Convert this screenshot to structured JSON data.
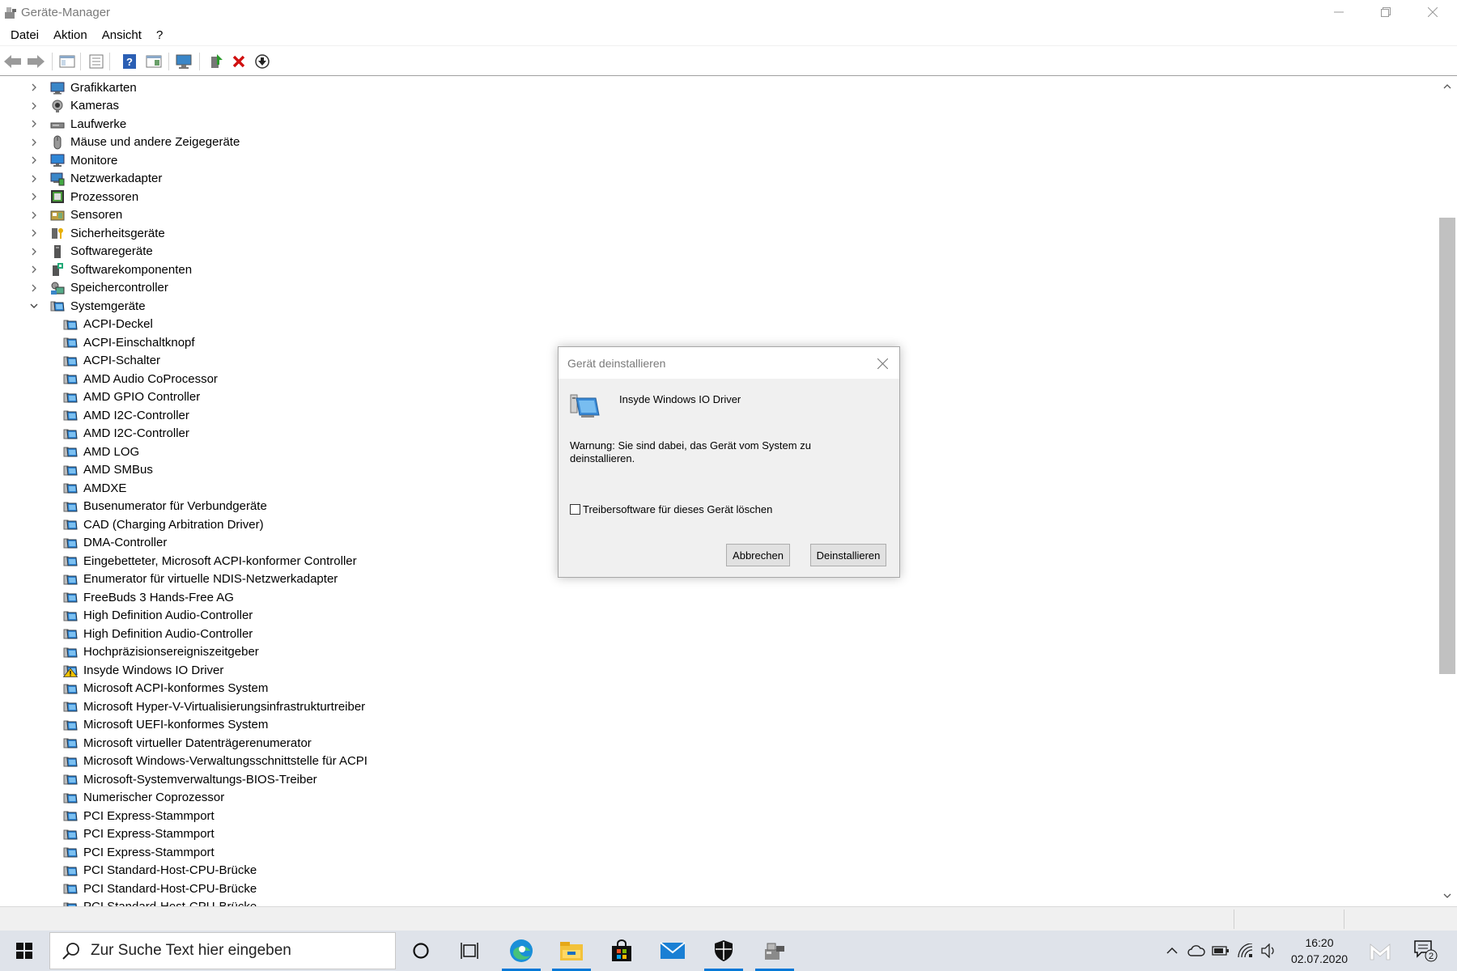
{
  "window": {
    "title": "Geräte-Manager"
  },
  "menu": [
    {
      "label": "Datei"
    },
    {
      "label": "Aktion"
    },
    {
      "label": "Ansicht"
    },
    {
      "label": "?"
    }
  ],
  "toolbar": {
    "icons": [
      "back-arrow-icon",
      "forward-arrow-icon",
      "console-tree-icon",
      "properties-icon",
      "help-icon",
      "action-pane-icon",
      "scan-hardware-icon",
      "update-driver-icon",
      "uninstall-device-icon",
      "disable-device-icon"
    ]
  },
  "tree": {
    "collapsed_categories": [
      {
        "label": "Grafikkarten",
        "icon": "display-adapter-icon"
      },
      {
        "label": "Kameras",
        "icon": "camera-icon"
      },
      {
        "label": "Laufwerke",
        "icon": "disk-drive-icon"
      },
      {
        "label": "Mäuse und andere Zeigegeräte",
        "icon": "mouse-icon"
      },
      {
        "label": "Monitore",
        "icon": "monitor-icon"
      },
      {
        "label": "Netzwerkadapter",
        "icon": "network-adapter-icon"
      },
      {
        "label": "Prozessoren",
        "icon": "processor-icon"
      },
      {
        "label": "Sensoren",
        "icon": "sensor-icon"
      },
      {
        "label": "Sicherheitsgeräte",
        "icon": "security-device-icon"
      },
      {
        "label": "Softwaregeräte",
        "icon": "software-device-icon"
      },
      {
        "label": "Softwarekomponenten",
        "icon": "software-component-icon"
      },
      {
        "label": "Speichercontroller",
        "icon": "storage-controller-icon"
      }
    ],
    "expanded_category": {
      "label": "Systemgeräte",
      "icon": "system-device-icon"
    },
    "system_devices": [
      "ACPI-Deckel",
      "ACPI-Einschaltknopf",
      "ACPI-Schalter",
      "AMD Audio CoProcessor",
      "AMD GPIO Controller",
      "AMD I2C-Controller",
      "AMD I2C-Controller",
      "AMD LOG",
      "AMD SMBus",
      "AMDXE",
      "Busenumerator für Verbundgeräte",
      "CAD (Charging Arbitration Driver)",
      "DMA-Controller",
      "Eingebetteter, Microsoft ACPI-konformer Controller",
      "Enumerator für virtuelle NDIS-Netzwerkadapter",
      "FreeBuds 3 Hands-Free AG",
      "High Definition Audio-Controller",
      "High Definition Audio-Controller",
      "Hochpräzisionsereigniszeitgeber",
      "Insyde Windows IO Driver",
      "Microsoft ACPI-konformes System",
      "Microsoft Hyper-V-Virtualisierungsinfrastrukturtreiber",
      "Microsoft UEFI-konformes System",
      "Microsoft virtueller Datenträgerenumerator",
      "Microsoft Windows-Verwaltungsschnittstelle für ACPI",
      "Microsoft-Systemverwaltungs-BIOS-Treiber",
      "Numerischer Coprozessor",
      "PCI Express-Stammport",
      "PCI Express-Stammport",
      "PCI Express-Stammport",
      "PCI Standard-Host-CPU-Brücke",
      "PCI Standard-Host-CPU-Brücke",
      "PCI Standard-Host-CPU-Brücke"
    ],
    "warning_device": "Insyde Windows IO Driver"
  },
  "dialog": {
    "title": "Gerät deinstallieren",
    "device_name": "Insyde Windows IO Driver",
    "warning": "Warnung: Sie sind dabei, das Gerät vom System zu deinstallieren.",
    "checkbox_label": "Treibersoftware für dieses Gerät löschen",
    "checkbox_checked": false,
    "cancel_label": "Abbrechen",
    "uninstall_label": "Deinstallieren"
  },
  "taskbar": {
    "search_placeholder": "Zur Suche Text hier eingeben",
    "apps": [
      "cortana-icon",
      "task-view-icon",
      "edge-icon",
      "file-explorer-icon",
      "store-icon",
      "mail-icon",
      "defender-icon",
      "device-manager-icon"
    ],
    "time": "16:20",
    "date": "02.07.2020",
    "notification_count": "2"
  },
  "colors": {
    "accent": "#0078d7",
    "taskbar_bg": "#dfe3ea",
    "dialog_bg": "#f0f0f0",
    "warning_yellow": "#f2c200"
  }
}
